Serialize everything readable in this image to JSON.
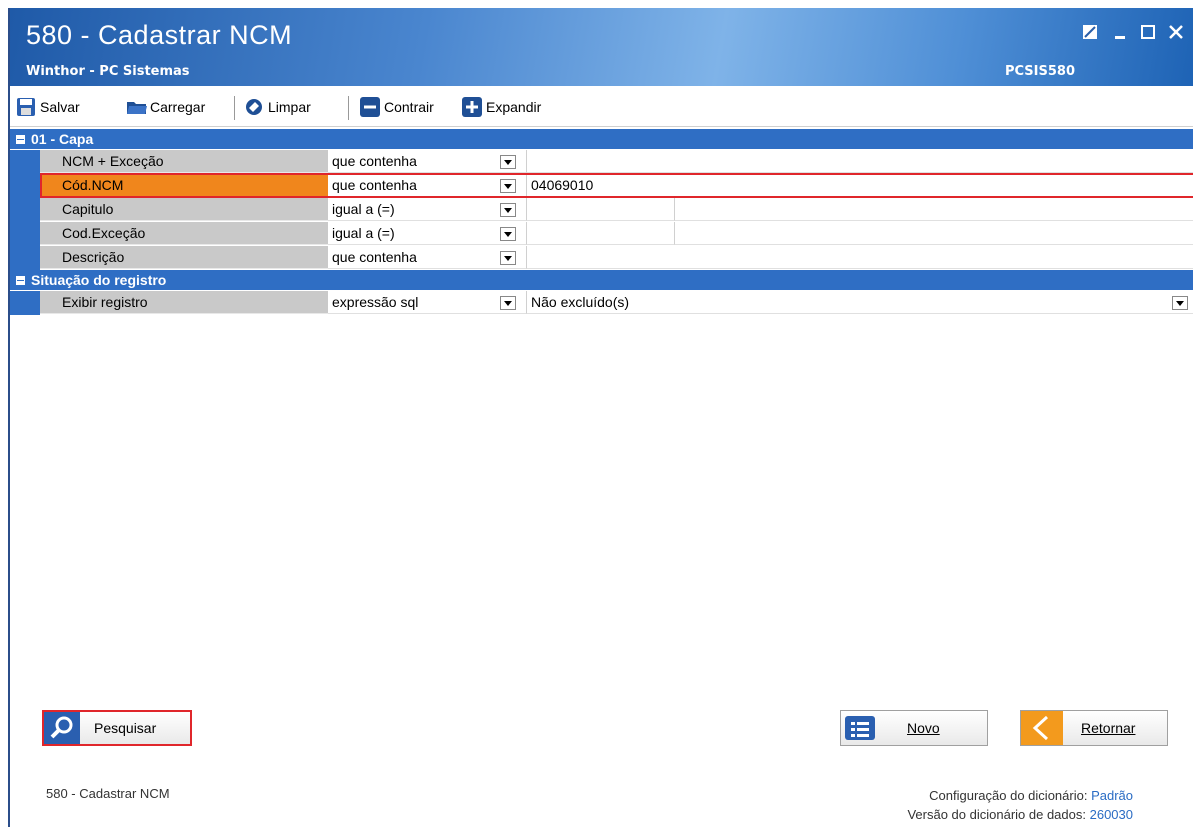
{
  "window": {
    "title": "580 - Cadastrar  NCM",
    "subtitle": "Winthor - PC Sistemas",
    "program_code": "PCSIS580"
  },
  "toolbar": {
    "save_label": "Salvar",
    "load_label": "Carregar",
    "clear_label": "Limpar",
    "collapse_label": "Contrair",
    "expand_label": "Expandir"
  },
  "sections": [
    {
      "title": "01 - Capa",
      "rows": [
        {
          "label": "NCM + Exceção",
          "operator": "que contenha",
          "value": ""
        },
        {
          "label": "Cód.NCM",
          "operator": "que contenha",
          "value": "04069010",
          "selected": true
        },
        {
          "label": "Capitulo",
          "operator": "igual a (=)",
          "value": ""
        },
        {
          "label": "Cod.Exceção",
          "operator": "igual a (=)",
          "value": ""
        },
        {
          "label": "Descrição",
          "operator": "que contenha",
          "value": ""
        }
      ]
    },
    {
      "title": "Situação do registro",
      "rows": [
        {
          "label": "Exibir registro",
          "operator": "expressão sql",
          "value": "Não excluído(s)"
        }
      ]
    }
  ],
  "buttons": {
    "search_label": "Pesquisar",
    "new_label": "Novo",
    "return_label": "Retornar"
  },
  "footer": {
    "program": "580 - Cadastrar  NCM",
    "dict_config_label": "Configuração do dicionário:",
    "dict_config_value": "Padrão",
    "dict_version_label": "Versão do dicionário de dados:",
    "dict_version_value": "260030"
  },
  "colors": {
    "title_blue": "#2f6ec4",
    "selected_label": "#f0861c",
    "highlight_border": "#e0262b",
    "retornar_orange": "#f39a1d"
  }
}
